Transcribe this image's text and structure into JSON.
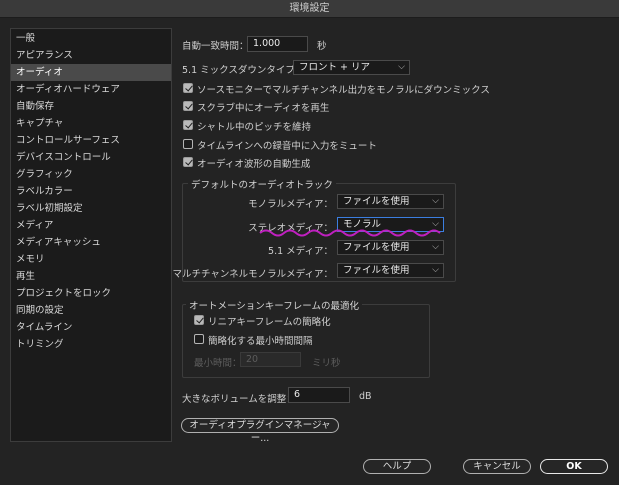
{
  "window": {
    "title": "環境設定"
  },
  "sidebar": {
    "items": [
      {
        "label": "一般"
      },
      {
        "label": "アピアランス"
      },
      {
        "label": "オーディオ"
      },
      {
        "label": "オーディオハードウェア"
      },
      {
        "label": "自動保存"
      },
      {
        "label": "キャプチャ"
      },
      {
        "label": "コントロールサーフェス"
      },
      {
        "label": "デバイスコントロール"
      },
      {
        "label": "グラフィック"
      },
      {
        "label": "ラベルカラー"
      },
      {
        "label": "ラベル初期設定"
      },
      {
        "label": "メディア"
      },
      {
        "label": "メディアキャッシュ"
      },
      {
        "label": "メモリ"
      },
      {
        "label": "再生"
      },
      {
        "label": "プロジェクトをロック"
      },
      {
        "label": "同期の設定"
      },
      {
        "label": "タイムライン"
      },
      {
        "label": "トリミング"
      }
    ],
    "selected_index": 2
  },
  "audio": {
    "auto_match_label": "自動一致時間：",
    "auto_match_value": "1.000",
    "auto_match_unit": "秒",
    "downmix_label": "5.1 ミックスダウンタイプ：",
    "downmix_value": "フロント + リア",
    "checkboxes": [
      {
        "label": "ソースモニターでマルチチャンネル出力をモノラルにダウンミックス",
        "checked": true
      },
      {
        "label": "スクラブ中にオーディオを再生",
        "checked": true
      },
      {
        "label": "シャトル中のピッチを維持",
        "checked": true
      },
      {
        "label": "タイムラインへの録音中に入力をミュート",
        "checked": false
      },
      {
        "label": "オーディオ波形の自動生成",
        "checked": true
      }
    ]
  },
  "default_tracks": {
    "title": "デフォルトのオーディオトラック",
    "mono_label": "モノラルメディア：",
    "mono_value": "ファイルを使用",
    "stereo_label": "ステレオメディア：",
    "stereo_value": "モノラル",
    "five_one_label": "5.1 メディア：",
    "five_one_value": "ファイルを使用",
    "multichannel_label": "マルチチャンネルモノラルメディア：",
    "multichannel_value": "ファイルを使用",
    "highlight_color": "#c020c0"
  },
  "automation": {
    "title": "オートメーションキーフレームの最適化",
    "linear_label": "リニアキーフレームの簡略化",
    "linear_checked": true,
    "min_interval_label": "簡略化する最小時間間隔",
    "min_interval_checked": false,
    "min_time_label": "最小時間：",
    "min_time_value": "20",
    "min_time_unit": "ミリ秒"
  },
  "volume": {
    "label": "大きなボリュームを調整：",
    "value": "6",
    "unit": "dB"
  },
  "plugin_button": "オーディオプラグインマネージャー...",
  "footer": {
    "help": "ヘルプ",
    "cancel": "キャンセル",
    "ok": "OK"
  }
}
